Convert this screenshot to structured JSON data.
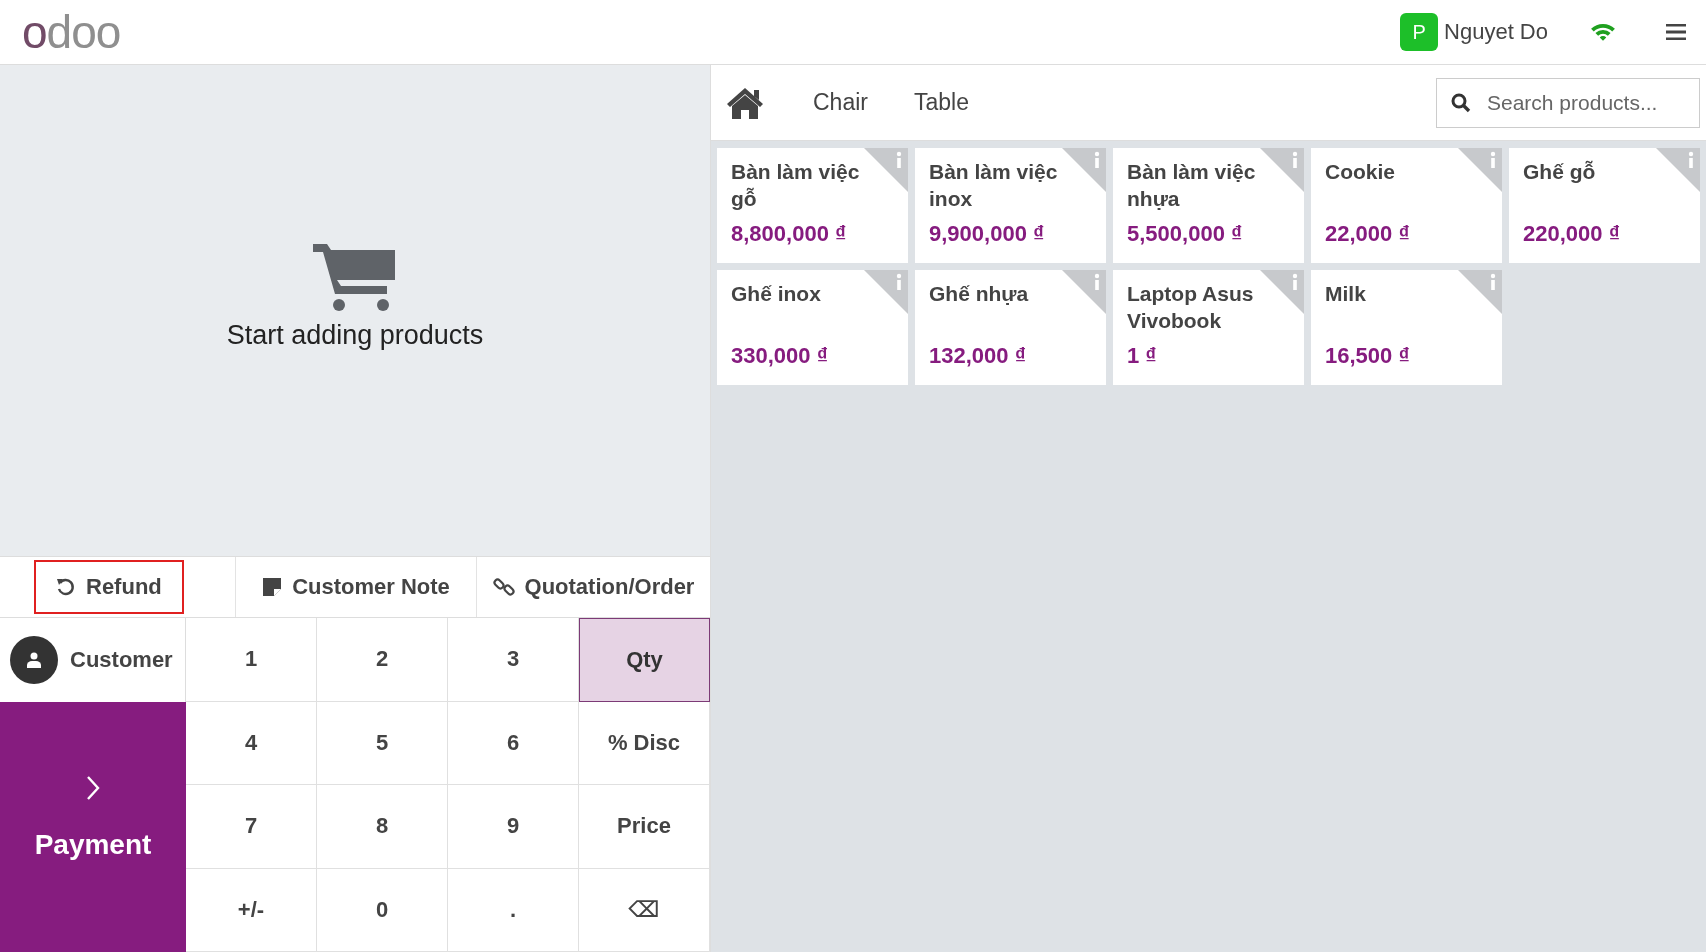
{
  "top_bar": {
    "logo": "odoo",
    "user": {
      "initial": "P",
      "name": "Nguyet Do"
    }
  },
  "order": {
    "empty_message": "Start adding products"
  },
  "control_buttons": [
    {
      "label": "Refund",
      "highlighted": true
    },
    {
      "label": "Customer Note",
      "highlighted": false
    },
    {
      "label": "Quotation/Order",
      "highlighted": false
    }
  ],
  "customer_button": {
    "label": "Customer"
  },
  "payment_button": {
    "label": "Payment"
  },
  "numpad": [
    {
      "label": "1",
      "selected": false
    },
    {
      "label": "2",
      "selected": false
    },
    {
      "label": "3",
      "selected": false
    },
    {
      "label": "Qty",
      "selected": true
    },
    {
      "label": "4",
      "selected": false
    },
    {
      "label": "5",
      "selected": false
    },
    {
      "label": "6",
      "selected": false
    },
    {
      "label": "% Disc",
      "selected": false
    },
    {
      "label": "7",
      "selected": false
    },
    {
      "label": "8",
      "selected": false
    },
    {
      "label": "9",
      "selected": false
    },
    {
      "label": "Price",
      "selected": false
    },
    {
      "label": "+/-",
      "selected": false
    },
    {
      "label": "0",
      "selected": false
    },
    {
      "label": ".",
      "selected": false
    },
    {
      "label": "⌫",
      "selected": false
    }
  ],
  "categories": [
    {
      "label": "Chair"
    },
    {
      "label": "Table"
    }
  ],
  "search": {
    "placeholder": "Search products..."
  },
  "products": [
    {
      "name": "Bàn làm việc gỗ",
      "price": "8,800,000 ₫"
    },
    {
      "name": "Bàn làm việc inox",
      "price": "9,900,000 ₫"
    },
    {
      "name": "Bàn làm việc nhựa",
      "price": "5,500,000 ₫"
    },
    {
      "name": "Cookie",
      "price": "22,000 ₫"
    },
    {
      "name": "Ghế gỗ",
      "price": "220,000 ₫"
    },
    {
      "name": "Ghế inox",
      "price": "330,000 ₫"
    },
    {
      "name": "Ghế nhựa",
      "price": "132,000 ₫"
    },
    {
      "name": "Laptop Asus Vivobook",
      "price": "1 ₫"
    },
    {
      "name": "Milk",
      "price": "16,500 ₫"
    }
  ]
}
